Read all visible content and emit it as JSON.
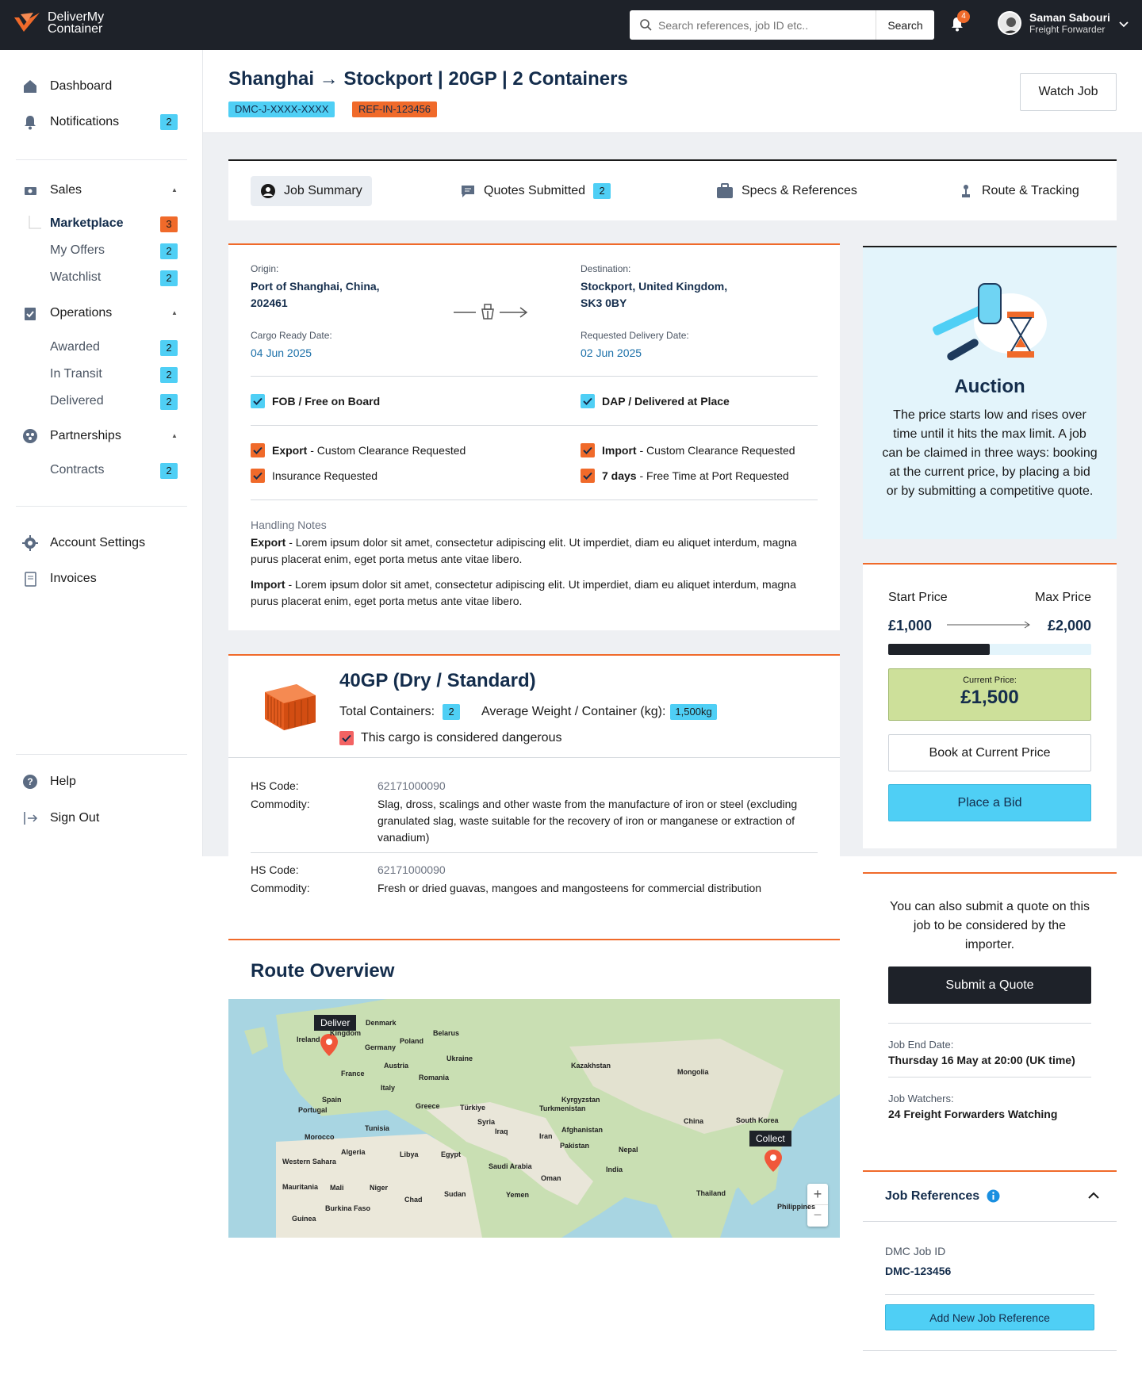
{
  "brand": {
    "line1": "DeliverMy",
    "line2": "Container"
  },
  "search": {
    "placeholder": "Search references, job ID etc..",
    "button": "Search"
  },
  "notifications_count": "4",
  "user": {
    "name": "Saman Sabouri",
    "role": "Freight Forwarder"
  },
  "sidebar": {
    "dashboard": "Dashboard",
    "notifications": {
      "label": "Notifications",
      "count": "2"
    },
    "sales": "Sales",
    "marketplace": {
      "label": "Marketplace",
      "count": "3"
    },
    "my_offers": {
      "label": "My Offers",
      "count": "2"
    },
    "watchlist": {
      "label": "Watchlist",
      "count": "2"
    },
    "operations": "Operations",
    "awarded": {
      "label": "Awarded",
      "count": "2"
    },
    "in_transit": {
      "label": "In Transit",
      "count": "2"
    },
    "delivered": {
      "label": "Delivered",
      "count": "2"
    },
    "partnerships": "Partnerships",
    "contracts": {
      "label": "Contracts",
      "count": "2"
    },
    "account_settings": "Account Settings",
    "invoices": "Invoices",
    "help": "Help",
    "sign_out": "Sign Out"
  },
  "job": {
    "title": "Shanghai → Stockport | 20GP | 2 Containers",
    "dmc_tag": "DMC-J-XXXX-XXXX",
    "ref_tag": "REF-IN-123456",
    "watch_button": "Watch Job"
  },
  "tabs": {
    "summary": "Job Summary",
    "quotes": "Quotes Submitted",
    "quotes_count": "2",
    "specs": "Specs & References",
    "route": "Route & Tracking"
  },
  "summary": {
    "origin_label": "Origin:",
    "origin_line1": "Port of Shanghai, China,",
    "origin_line2": "202461",
    "dest_label": "Destination:",
    "dest_line1": "Stockport, United Kingdom,",
    "dest_line2": "SK3 0BY",
    "ready_label": "Cargo Ready Date:",
    "ready_date": "04 Jun 2025",
    "delivery_label": "Requested Delivery Date:",
    "delivery_date": "02 Jun 2025",
    "fob": "FOB / Free on Board",
    "dap": "DAP / Delivered at Place",
    "export_bold": "Export",
    "export_rest": " - Custom Clearance Requested",
    "import_bold": "Import",
    "import_rest": " - Custom Clearance Requested",
    "insurance": "Insurance Requested",
    "days_bold": "7 days",
    "days_rest": " - Free Time at Port Requested",
    "notes_title": "Handling Notes",
    "note1_bold": "Export",
    "note1_text": " - Lorem ipsum dolor sit amet, consectetur adipiscing elit. Ut imperdiet, diam eu aliquet interdum, magna purus placerat enim, eget porta metus ante vitae libero.",
    "note2_bold": "Import",
    "note2_text": " - Lorem ipsum dolor sit amet, consectetur adipiscing elit. Ut imperdiet, diam eu aliquet interdum, magna purus placerat enim, eget porta metus ante vitae libero."
  },
  "container": {
    "title": "40GP (Dry / Standard)",
    "total_label": "Total Containers:",
    "total": "2",
    "weight_label": "Average Weight / Container (kg):",
    "weight": "1,500kg",
    "dangerous": "This cargo is considered dangerous",
    "hs_label": "HS Code:",
    "commodity_label": "Commodity:",
    "items": [
      {
        "hs": "62171000090",
        "commodity": "Slag, dross, scalings and other waste from the manufacture of iron or steel (excluding granulated slag, waste suitable for the recovery of iron or manganese or extraction of vanadium)"
      },
      {
        "hs": "62171000090",
        "commodity": "Fresh or dried guavas, mangoes and mangosteens for commercial distribution"
      }
    ]
  },
  "route": {
    "title": "Route Overview",
    "deliver": "Deliver",
    "collect": "Collect",
    "map_labels": [
      "Denmark",
      "Ireland",
      "Kingdom",
      "Belarus",
      "Poland",
      "Germany",
      "Ukraine",
      "France",
      "Austria",
      "Kazakhstan",
      "Mongolia",
      "Romania",
      "Italy",
      "Spain",
      "Kyrgyzstan",
      "Portugal",
      "Greece",
      "Türkiye",
      "Turkmenistan",
      "China",
      "South Korea",
      "Tunisia",
      "Syria",
      "Iraq",
      "Afghanistan",
      "Iran",
      "Morocco",
      "Algeria",
      "Libya",
      "Egypt",
      "Pakistan",
      "Nepal",
      "Western Sahara",
      "Saudi Arabia",
      "India",
      "Oman",
      "Mauritania",
      "Mali",
      "Niger",
      "Chad",
      "Sudan",
      "Yemen",
      "Thailand",
      "Philippines",
      "Burkina Faso",
      "Guinea"
    ]
  },
  "auction": {
    "title": "Auction",
    "text": "The price starts low and rises over time until it hits the max limit. A job can be claimed in three ways: booking at the current price, by placing a bid or by submitting a competitive quote."
  },
  "pricing": {
    "start_label": "Start Price",
    "max_label": "Max Price",
    "start": "£1,000",
    "max": "£2,000",
    "progress": 0.5,
    "current_label": "Current Price:",
    "current": "£1,500",
    "book_button": "Book at Current Price",
    "bid_button": "Place a Bid"
  },
  "quote": {
    "text": "You can also submit a quote on this job to be considered by the importer.",
    "button": "Submit a Quote",
    "end_label": "Job End Date:",
    "end_value": "Thursday 16 May at 20:00 (UK time)",
    "watchers_label": "Job Watchers:",
    "watchers_value": "24 Freight Forwarders Watching"
  },
  "references": {
    "title": "Job References",
    "dmc_label": "DMC Job ID",
    "dmc_value": "DMC-123456",
    "add_button": "Add New Job Reference"
  },
  "colors": {
    "accent_blue": "#4fcff5",
    "accent_orange": "#f06a2a",
    "navy": "#142d4c",
    "dark": "#1e2229",
    "price_green": "#cde09a"
  }
}
